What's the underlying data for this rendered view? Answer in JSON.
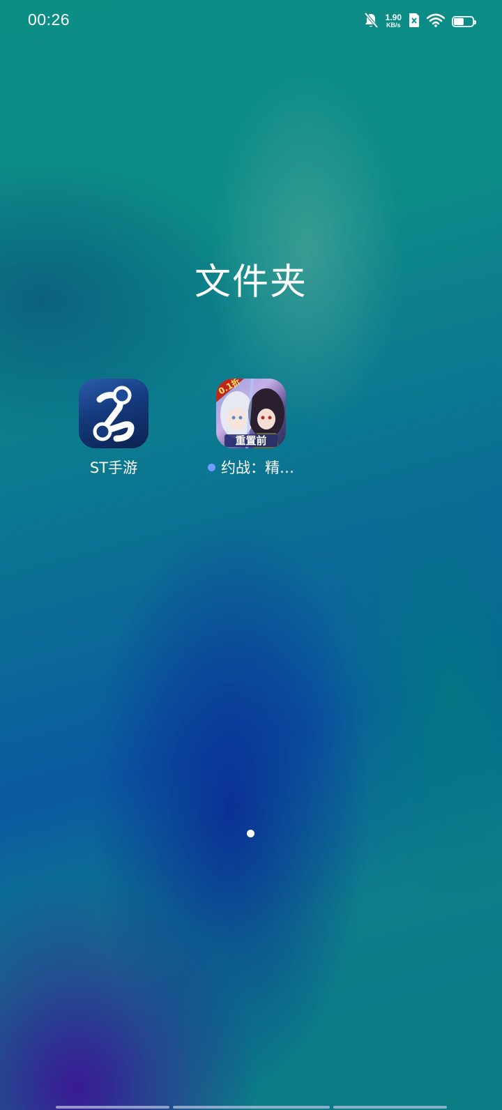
{
  "status_bar": {
    "time": "00:26",
    "network_speed_value": "1.90",
    "network_speed_unit": "KB/s",
    "battery_level": 0.55,
    "icons": [
      "bell-off-icon",
      "sim-disabled-icon",
      "wifi-icon",
      "battery-icon"
    ]
  },
  "folder": {
    "title": "文件夹",
    "apps": [
      {
        "label": "ST手游",
        "icon": "st-shouyou-app-icon",
        "has_new_dot": false
      },
      {
        "label": "约战：精…",
        "icon": "yuezhan-game-app-icon",
        "has_new_dot": true,
        "icon_text_badge": "0.1折",
        "icon_text_banner": "重置前"
      }
    ]
  },
  "pagination": {
    "current_page": 1,
    "page_count": 1
  },
  "colors": {
    "new_dot": "#6e9cff",
    "text": "#ffffff"
  }
}
